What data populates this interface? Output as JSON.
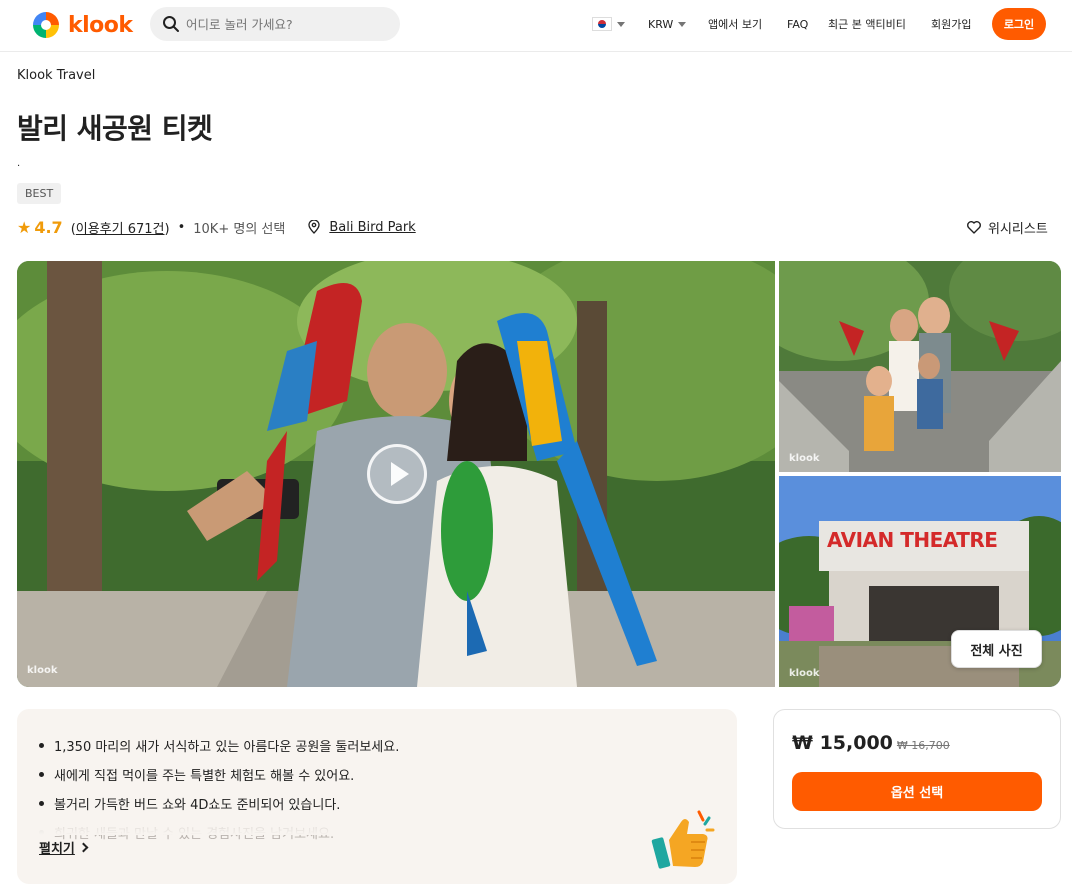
{
  "header": {
    "logo_text": "klook",
    "search": {
      "placeholder": "어디로 놀러 가세요?"
    },
    "language": {
      "icon": "korea-flag-icon"
    },
    "currency": "KRW",
    "app_link": "앱에서 보기",
    "faq": "FAQ",
    "recent": "최근 본 액티비티",
    "signup": "회원가입",
    "login": "로그인"
  },
  "breadcrumb": "Klook Travel",
  "title": "발리 새공원 티켓",
  "subtitle_dot": ".",
  "badge": "BEST",
  "rating": {
    "value": "4.7",
    "reviews_open": "(",
    "reviews": "이용후기 671건",
    "reviews_close": ")",
    "separator": "•",
    "booked": "10K+ 명의 선택",
    "location": "Bali Bird Park"
  },
  "wishlist": "위시리스트",
  "gallery": {
    "watermark": "klook",
    "sign": "AVIAN THEATRE",
    "all_photos": "전체 사진"
  },
  "highlights": {
    "items": [
      "1,350 마리의 새가 서식하고 있는 아름다운 공원을 둘러보세요.",
      "새에게 직접 먹이를 주는 특별한 체험도 해볼 수 있어요.",
      "볼거리 가득한 버드 쇼와 4D쇼도 준비되어 있습니다.",
      "희귀한 새들과 만날 수 있는 경험사진을 남겨보세요."
    ],
    "expand": "펼치기"
  },
  "price": {
    "current": "₩ 15,000",
    "original": "₩ 16,700",
    "button": "옵션 선택"
  },
  "colors": {
    "accent": "#ff5b00",
    "star": "#f09b0a",
    "highlight_bg": "#f8f4f0"
  }
}
